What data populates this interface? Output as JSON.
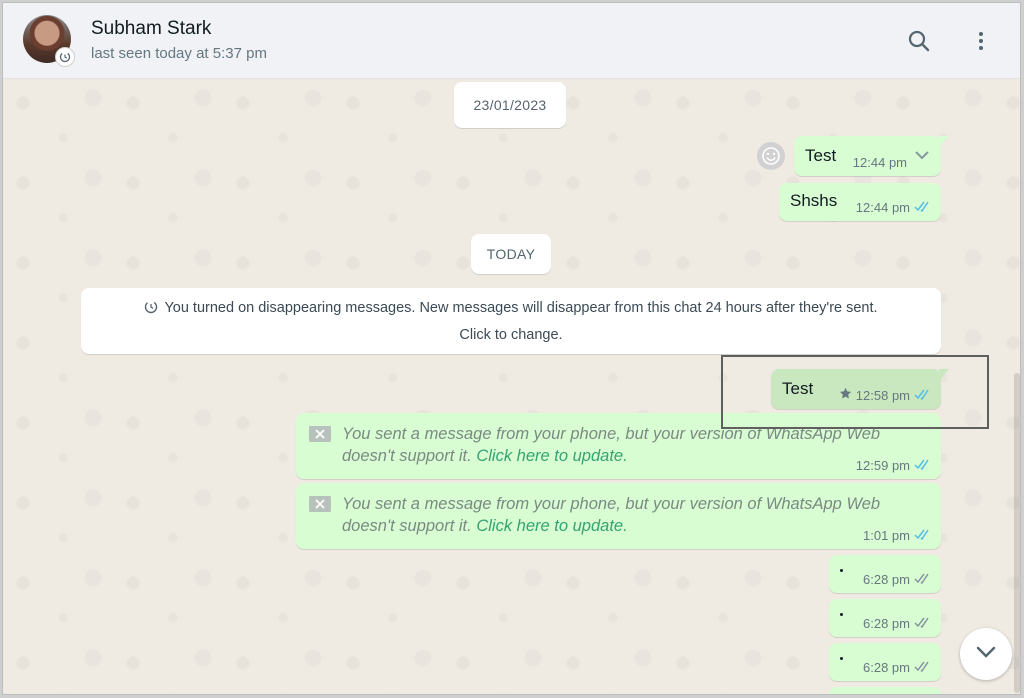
{
  "header": {
    "contact_name": "Subham Stark",
    "last_seen": "last seen today at 5:37 pm"
  },
  "date_chips": {
    "first": "23/01/2023",
    "today": "TODAY"
  },
  "messages_before": [
    {
      "text": "Test",
      "time": "12:44 pm"
    },
    {
      "text": "Shshs",
      "time": "12:44 pm"
    }
  ],
  "system_notice": {
    "line1": "You turned on disappearing messages. New messages will disappear from this chat 24 hours after they're sent.",
    "line2": "Click to change."
  },
  "starred_message": {
    "text": "Test",
    "time": "12:58 pm"
  },
  "unsupported": {
    "text_prefix": "You sent a message from your phone, but your version of WhatsApp Web doesn't support it.",
    "link": "Click here to update.",
    "times": [
      "12:59 pm",
      "1:01 pm"
    ]
  },
  "dot_messages": [
    {
      "time": "6:28 pm"
    },
    {
      "time": "6:28 pm"
    },
    {
      "time": "6:28 pm"
    }
  ],
  "colors": {
    "outgoing_bubble": "#d9fdd3",
    "read_tick": "#53bdeb",
    "delivered_tick": "#8696a0",
    "link": "#35a372"
  },
  "icons": {
    "search": "search-icon",
    "menu": "kebab-menu-icon",
    "scroll_down": "chevron-down-icon"
  }
}
